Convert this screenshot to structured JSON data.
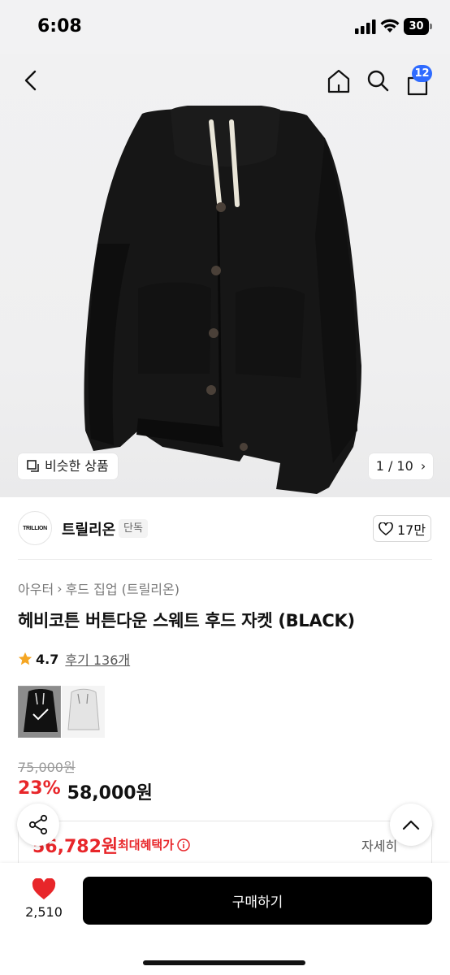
{
  "status_bar": {
    "time": "6:08",
    "battery": "30",
    "icons": [
      "signal-icon",
      "wifi-icon",
      "battery-icon"
    ]
  },
  "header": {
    "icons": [
      "back-icon",
      "home-icon",
      "search-icon",
      "cart-icon"
    ],
    "cart_badge": "12"
  },
  "gallery": {
    "similar_label": "비슷한 상품",
    "page_indicator": "1 / 10",
    "image": "black hooded button-down jacket"
  },
  "brand": {
    "logo_text": "TRILLION",
    "name": "트릴리온",
    "tag": "단독",
    "likes": "17만"
  },
  "product": {
    "breadcrumb": [
      "아우터",
      "후드 집업 (트릴리온)"
    ],
    "title": "헤비코튼 버튼다운 스웨트 후드 자켓 (BLACK)",
    "rating": "4.7",
    "reviews": "후기 136개"
  },
  "swatches": [
    {
      "name": "black",
      "selected": true
    },
    {
      "name": "white",
      "selected": false
    }
  ],
  "price": {
    "original": "75,000원",
    "discount": "23%",
    "sale": "58,000원"
  },
  "benefit": {
    "price": "56,782원",
    "label": "최대혜택가",
    "detail": "자세히"
  },
  "bottom_bar": {
    "like_count": "2,510",
    "buy_label": "구매하기"
  },
  "colors": {
    "accent": "#e8262a",
    "badge": "#2f6bff",
    "buy_button": "#000000"
  }
}
